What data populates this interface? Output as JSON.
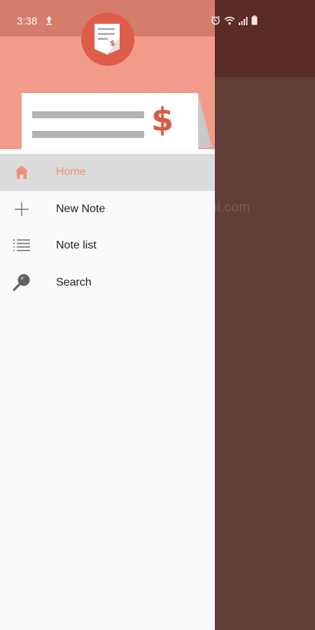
{
  "status_bar": {
    "time": "3:38",
    "left_icons": [
      "cloud-upload-icon"
    ],
    "right_icons": [
      "alarm-icon",
      "wifi-icon",
      "signal-icon",
      "battery-icon"
    ]
  },
  "drawer": {
    "header": {
      "logo_icon": "receipt-dollar-icon",
      "dollar_symbol": "$"
    },
    "menu": [
      {
        "label": "Home",
        "icon": "home-icon",
        "active": true
      },
      {
        "label": "New Note",
        "icon": "plus-icon",
        "active": false
      },
      {
        "label": "Note list",
        "icon": "list-icon",
        "active": false
      },
      {
        "label": "Search",
        "icon": "search-icon",
        "active": false
      }
    ]
  },
  "background": {
    "partial_text": "il.com"
  },
  "colors": {
    "accent": "#f0907c",
    "header": "#f29b8b",
    "logo_circle": "#de5d4a",
    "toolbar_dark": "#5a2c23",
    "scrim_bg": "#633e38"
  }
}
